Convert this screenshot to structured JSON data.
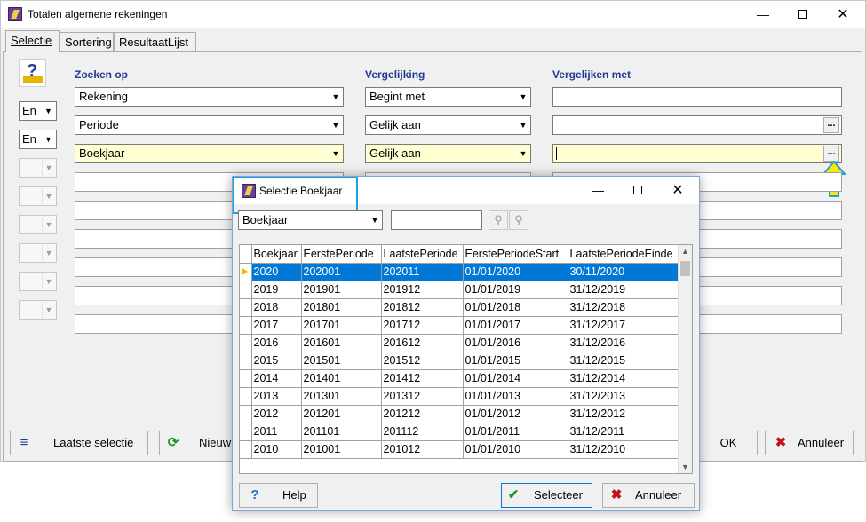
{
  "window": {
    "title": "Totalen algemene rekeningen"
  },
  "tabs": [
    "Selectie",
    "Sortering",
    "ResultaatLijst"
  ],
  "headers": {
    "search_on": "Zoeken op",
    "comparison": "Vergelijking",
    "compare_with": "Vergelijken met"
  },
  "connectors": [
    "En",
    "En"
  ],
  "criteria": [
    {
      "field": "Rekening",
      "comparison": "Begint met",
      "value": ""
    },
    {
      "field": "Periode",
      "comparison": "Gelijk aan",
      "value": ""
    },
    {
      "field": "Boekjaar",
      "comparison": "Gelijk aan",
      "value": ""
    }
  ],
  "buttons": {
    "last_selection": "Laatste selectie",
    "new": "Nieuw",
    "ok": "OK",
    "cancel": "Annuleer"
  },
  "dialog": {
    "title": "Selectie Boekjaar",
    "search_field": "Boekjaar",
    "search_value": "",
    "columns": [
      "Boekjaar",
      "EerstePeriode",
      "LaatstePeriode",
      "EerstePeriodeStart",
      "LaatstePeriodeEinde"
    ],
    "rows": [
      [
        "2020",
        "202001",
        "202011",
        "01/01/2020",
        "30/11/2020"
      ],
      [
        "2019",
        "201901",
        "201912",
        "01/01/2019",
        "31/12/2019"
      ],
      [
        "2018",
        "201801",
        "201812",
        "01/01/2018",
        "31/12/2018"
      ],
      [
        "2017",
        "201701",
        "201712",
        "01/01/2017",
        "31/12/2017"
      ],
      [
        "2016",
        "201601",
        "201612",
        "01/01/2016",
        "31/12/2016"
      ],
      [
        "2015",
        "201501",
        "201512",
        "01/01/2015",
        "31/12/2015"
      ],
      [
        "2014",
        "201401",
        "201412",
        "01/01/2014",
        "31/12/2014"
      ],
      [
        "2013",
        "201301",
        "201312",
        "01/01/2013",
        "31/12/2013"
      ],
      [
        "2012",
        "201201",
        "201212",
        "01/01/2012",
        "31/12/2012"
      ],
      [
        "2011",
        "201101",
        "201112",
        "01/01/2011",
        "31/12/2011"
      ],
      [
        "2010",
        "201001",
        "201012",
        "01/01/2010",
        "31/12/2010"
      ]
    ],
    "buttons": {
      "help": "Help",
      "select": "Selecteer",
      "cancel": "Annuleer"
    }
  },
  "colors": {
    "accent": "#0078d7",
    "highlight_field": "#ffffd2",
    "header_text": "#1f3a93",
    "callout": "#1ba1e2",
    "arrow_fill": "#ffe600"
  }
}
